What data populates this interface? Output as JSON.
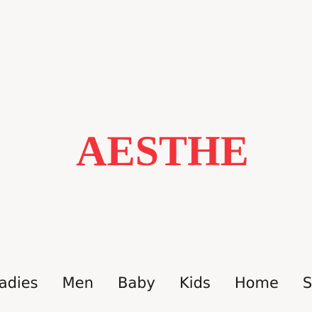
{
  "header": {
    "logo_text": "AESTHE"
  },
  "nav": {
    "items": [
      {
        "label": "Ladies"
      },
      {
        "label": "Men"
      },
      {
        "label": "Baby"
      },
      {
        "label": "Kids"
      },
      {
        "label": "Home"
      },
      {
        "label": "Sport"
      }
    ]
  },
  "colors": {
    "background": "#f9f7f5",
    "logo": "#f2333b",
    "nav_text": "#1a1a1a"
  }
}
